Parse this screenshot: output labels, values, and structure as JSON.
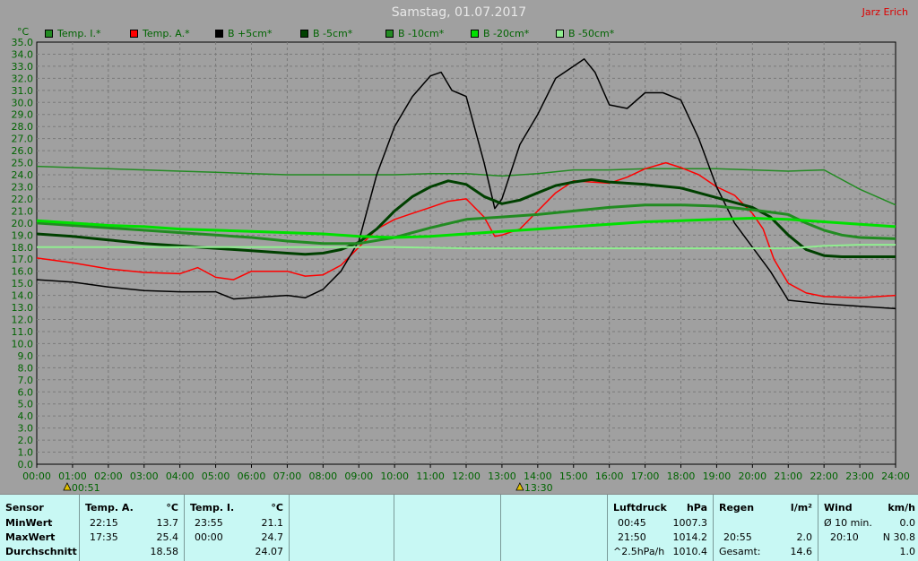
{
  "title": "Samstag, 01.07.2017",
  "author": "Jarz Erich",
  "unit": "°C",
  "markers": [
    "00:51",
    "13:30"
  ],
  "colors": {
    "background": "#a0a0a0",
    "grid": "#7a7a7a",
    "axis_text": "#006400",
    "stats_bg": "#c8f8f4"
  },
  "chart_data": {
    "type": "line",
    "x_ticks": [
      "00:00",
      "01:00",
      "02:00",
      "03:00",
      "04:00",
      "05:00",
      "06:00",
      "07:00",
      "08:00",
      "09:00",
      "10:00",
      "11:00",
      "12:00",
      "13:00",
      "14:00",
      "15:00",
      "16:00",
      "17:00",
      "18:00",
      "19:00",
      "20:00",
      "21:00",
      "22:00",
      "23:00",
      "24:00"
    ],
    "y_ticks": [
      "0.0",
      "1.0",
      "2.0",
      "3.0",
      "4.0",
      "5.0",
      "6.0",
      "7.0",
      "8.0",
      "9.0",
      "10.0",
      "11.0",
      "12.0",
      "13.0",
      "14.0",
      "15.0",
      "16.0",
      "17.0",
      "18.0",
      "19.0",
      "20.0",
      "21.0",
      "22.0",
      "23.0",
      "24.0",
      "25.0",
      "26.0",
      "27.0",
      "28.0",
      "29.0",
      "30.0",
      "31.0",
      "32.0",
      "33.0",
      "34.0",
      "35.0"
    ],
    "xlim": [
      0,
      24
    ],
    "ylim": [
      0,
      35
    ],
    "grid": true,
    "legend_position": "top",
    "series": [
      {
        "name": "Temp. I.*",
        "color": "#228b22",
        "width": 1.5,
        "x": [
          0,
          1,
          2,
          3,
          4,
          5,
          6,
          7,
          8,
          9,
          10,
          11,
          12,
          13,
          14,
          15,
          16,
          17,
          18,
          19,
          20,
          21,
          22,
          22.5,
          23,
          24
        ],
        "y": [
          24.7,
          24.6,
          24.5,
          24.4,
          24.3,
          24.2,
          24.1,
          24.0,
          24.0,
          24.0,
          24.0,
          24.1,
          24.1,
          23.9,
          24.1,
          24.4,
          24.4,
          24.5,
          24.5,
          24.5,
          24.4,
          24.3,
          24.4,
          23.6,
          22.8,
          21.5
        ]
      },
      {
        "name": "Temp. A.*",
        "color": "#ff0000",
        "width": 1.5,
        "x": [
          0,
          1,
          2,
          3,
          4,
          4.5,
          5,
          5.5,
          6,
          7,
          7.5,
          8,
          8.5,
          9,
          9.5,
          10,
          10.5,
          11,
          11.5,
          12,
          12.5,
          12.8,
          13,
          13.5,
          14,
          14.5,
          15,
          15.5,
          16,
          16.5,
          17,
          17.58,
          18,
          18.5,
          19,
          19.5,
          20,
          20.3,
          20.6,
          21,
          21.5,
          22,
          23,
          24
        ],
        "y": [
          17.1,
          16.7,
          16.2,
          15.9,
          15.8,
          16.3,
          15.5,
          15.3,
          16.0,
          16.0,
          15.6,
          15.7,
          16.5,
          18.0,
          19.5,
          20.3,
          20.8,
          21.3,
          21.8,
          22.0,
          20.5,
          18.9,
          19.0,
          19.5,
          21.0,
          22.5,
          23.5,
          23.4,
          23.3,
          23.8,
          24.5,
          25.0,
          24.6,
          24.0,
          23.0,
          22.3,
          20.8,
          19.5,
          17.0,
          15.0,
          14.2,
          13.9,
          13.8,
          14.0
        ]
      },
      {
        "name": "B +5cm*",
        "color": "#000000",
        "width": 1.5,
        "x": [
          0,
          1,
          2,
          3,
          4,
          5,
          5.5,
          6,
          7,
          7.5,
          8,
          8.5,
          9,
          9.5,
          10,
          10.5,
          11,
          11.3,
          11.6,
          12,
          12.5,
          12.8,
          13,
          13.5,
          14,
          14.5,
          15,
          15.3,
          15.6,
          16,
          16.5,
          17,
          17.5,
          18,
          18.5,
          19,
          19.5,
          20,
          20.5,
          21,
          22,
          23,
          24
        ],
        "y": [
          15.3,
          15.1,
          14.7,
          14.4,
          14.3,
          14.3,
          13.7,
          13.8,
          14.0,
          13.8,
          14.5,
          16.0,
          18.5,
          24.0,
          28.0,
          30.5,
          32.2,
          32.5,
          31.0,
          30.5,
          25.0,
          21.2,
          22.0,
          26.5,
          29.0,
          32.0,
          33.0,
          33.6,
          32.5,
          29.8,
          29.5,
          30.8,
          30.8,
          30.2,
          27.0,
          23.0,
          20.0,
          18.0,
          16.0,
          13.6,
          13.3,
          13.1,
          12.9
        ]
      },
      {
        "name": "B -5cm*",
        "color": "#004000",
        "width": 3,
        "x": [
          0,
          1,
          2,
          3,
          4,
          5,
          6,
          7,
          7.5,
          8,
          8.5,
          9,
          9.5,
          10,
          10.5,
          11,
          11.5,
          12,
          12.5,
          13,
          13.5,
          14,
          14.5,
          15,
          15.5,
          16,
          17,
          18,
          19,
          20,
          20.5,
          21,
          21.5,
          22,
          22.5,
          23,
          24
        ],
        "y": [
          19.1,
          18.9,
          18.6,
          18.3,
          18.1,
          17.9,
          17.7,
          17.5,
          17.4,
          17.5,
          17.8,
          18.4,
          19.5,
          21.0,
          22.2,
          23.0,
          23.5,
          23.2,
          22.2,
          21.6,
          21.9,
          22.5,
          23.1,
          23.4,
          23.6,
          23.4,
          23.2,
          22.9,
          22.1,
          21.3,
          20.5,
          19.0,
          17.8,
          17.3,
          17.2,
          17.2,
          17.2
        ]
      },
      {
        "name": "B -10cm*",
        "color": "#228b22",
        "width": 3,
        "x": [
          0,
          1,
          2,
          3,
          4,
          5,
          6,
          7,
          8,
          9,
          10,
          11,
          12,
          13,
          14,
          15,
          16,
          17,
          18,
          19,
          20,
          21,
          21.5,
          22,
          22.5,
          23,
          24
        ],
        "y": [
          20.0,
          19.8,
          19.6,
          19.4,
          19.2,
          19.0,
          18.8,
          18.5,
          18.3,
          18.3,
          18.8,
          19.6,
          20.3,
          20.5,
          20.7,
          21.0,
          21.3,
          21.5,
          21.5,
          21.4,
          21.1,
          20.7,
          20.0,
          19.4,
          19.0,
          18.8,
          18.7
        ]
      },
      {
        "name": "B -20cm*",
        "color": "#00e000",
        "width": 3,
        "x": [
          0,
          1,
          2,
          3,
          4,
          5,
          6,
          7,
          8,
          9,
          10,
          11,
          12,
          13,
          14,
          15,
          16,
          17,
          18,
          19,
          20,
          21,
          22,
          23,
          24
        ],
        "y": [
          20.2,
          20.0,
          19.8,
          19.7,
          19.5,
          19.4,
          19.3,
          19.2,
          19.1,
          18.9,
          18.8,
          18.9,
          19.1,
          19.3,
          19.5,
          19.7,
          19.9,
          20.1,
          20.2,
          20.3,
          20.4,
          20.3,
          20.1,
          19.9,
          19.7
        ]
      },
      {
        "name": "B -50cm*",
        "color": "#90ee90",
        "width": 2,
        "x": [
          0,
          2,
          4,
          6,
          8,
          10,
          12,
          14,
          16,
          18,
          20,
          21,
          22,
          23,
          24
        ],
        "y": [
          18.0,
          18.0,
          18.0,
          18.0,
          18.0,
          18.0,
          17.9,
          17.9,
          17.9,
          17.9,
          17.9,
          17.9,
          18.1,
          18.2,
          18.2
        ]
      }
    ]
  },
  "stats": {
    "sensor": {
      "header": "Sensor",
      "rows": [
        "MinWert",
        "MaxWert",
        "Durchschnitt"
      ]
    },
    "temp_a": {
      "header": "Temp. A.",
      "unit": "°C",
      "min_time": "22:15",
      "min_val": "13.7",
      "max_time": "17:35",
      "max_val": "25.4",
      "avg": "18.58"
    },
    "temp_i": {
      "header": "Temp. I.",
      "unit": "°C",
      "min_time": "23:55",
      "min_val": "21.1",
      "max_time": "00:00",
      "max_val": "24.7",
      "avg": "24.07"
    },
    "luftdruck": {
      "header": "Luftdruck",
      "unit": "hPa",
      "min_time": "00:45",
      "min_val": "1007.3",
      "max_time": "21:50",
      "max_val": "1014.2",
      "avg_label": "^2.5hPa/h",
      "avg": "1010.4"
    },
    "regen": {
      "header": "Regen",
      "unit": "l/m²",
      "max_time": "20:55",
      "max_val": "2.0",
      "avg_label": "Gesamt:",
      "avg": "14.6"
    },
    "wind": {
      "header": "Wind",
      "unit": "km/h",
      "min_label": "Ø 10 min.",
      "min_val": "0.0",
      "max_time": "20:10",
      "max_val": "N 30.8",
      "avg": "1.0"
    }
  }
}
